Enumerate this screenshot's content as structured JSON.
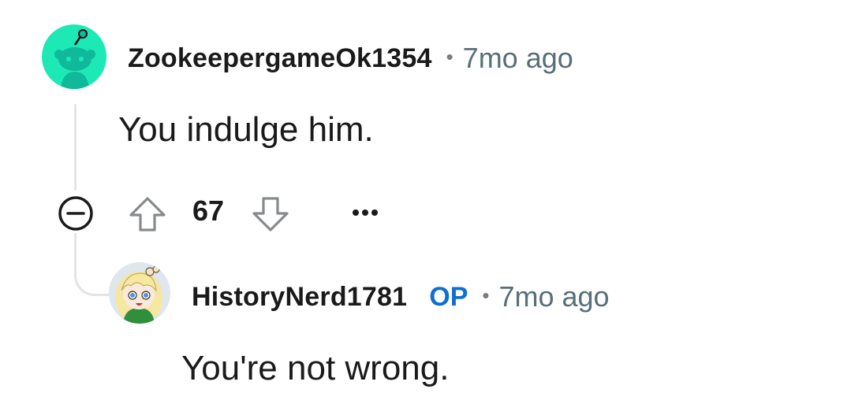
{
  "comments": [
    {
      "username": "ZookeepergameOk1354",
      "separator": "•",
      "timestamp": "7mo ago",
      "body": "You indulge him.",
      "score": "67",
      "more_label": "•••",
      "avatar": "reddit-snoo-avatar"
    },
    {
      "username": "HistoryNerd1781",
      "op_badge": "OP",
      "separator": "•",
      "timestamp": "7mo ago",
      "body": "You're not wrong.",
      "avatar": "anime-girl-avatar"
    }
  ],
  "icons": {
    "collapse": "minus-circle-icon",
    "upvote": "arrow-up-icon",
    "downvote": "arrow-down-icon",
    "more": "more-horizontal-icon"
  },
  "colors": {
    "avatar1_bg": "#1de9b6",
    "op_badge": "#0f6fd1",
    "timestamp": "#576f76",
    "thread_line": "#e2e4e6"
  }
}
